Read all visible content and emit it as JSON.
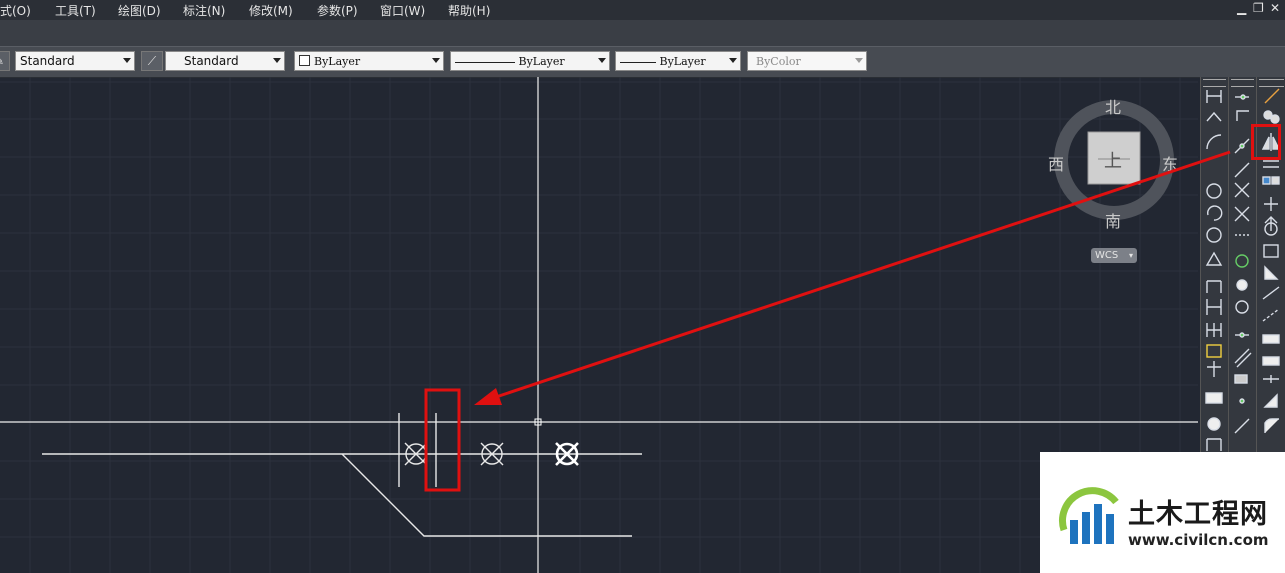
{
  "menu": {
    "items": [
      "式(O)",
      "工具(T)",
      "绘图(D)",
      "标注(N)",
      "修改(M)",
      "参数(P)",
      "窗口(W)",
      "帮助(H)"
    ],
    "window_controls": [
      "▁",
      "❐",
      "✕"
    ]
  },
  "toolbar": {
    "text_style": "Standard",
    "dim_style": "Standard",
    "layer_color": "ByLayer",
    "linetype": "ByLayer",
    "lineweight": "ByLayer",
    "plot_style": "ByColor"
  },
  "viewcube": {
    "north": "北",
    "south": "南",
    "east": "东",
    "west": "西",
    "face": "上",
    "wcs_label": "WCS"
  },
  "watermark": {
    "title": "土木工程网",
    "url": "www.civilcn.com"
  },
  "colors": {
    "canvas_bg": "#222732",
    "highlight_red": "#e01010",
    "crosshair": "#ffffff",
    "geometry": "#e8e8e8"
  }
}
